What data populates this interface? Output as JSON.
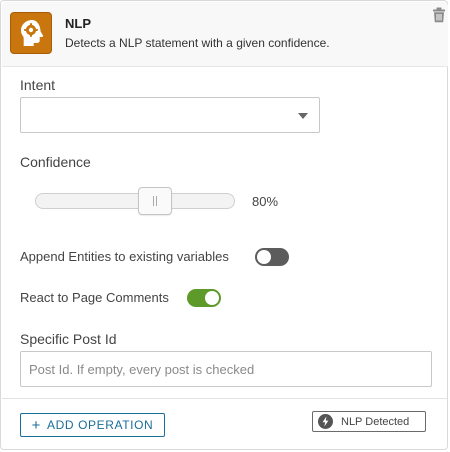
{
  "header": {
    "title": "NLP",
    "subtitle": "Detects a NLP statement with a given confidence."
  },
  "intent": {
    "label": "Intent",
    "selected_value": ""
  },
  "confidence": {
    "label": "Confidence",
    "value_percent": 80,
    "value_label": "80%"
  },
  "append_entities": {
    "label": "Append Entities to existing variables",
    "enabled": false
  },
  "react_comments": {
    "label": "React to Page Comments",
    "enabled": true
  },
  "post_id": {
    "label": "Specific Post Id",
    "value": "",
    "placeholder": "Post Id. If empty, every post is checked"
  },
  "footer": {
    "add_operation_label": "ADD OPERATION",
    "event_badge_label": "NLP Detected"
  },
  "colors": {
    "icon_bg": "#c9760e",
    "toggle_on": "#5e9a2a",
    "toggle_off": "#5c5c5c",
    "accent_blue": "#1a6e9a"
  },
  "icons": {
    "app": "head-gear-icon",
    "delete": "trash-icon",
    "dropdown": "chevron-down-icon",
    "add": "plus-icon",
    "badge": "lightning-icon"
  }
}
